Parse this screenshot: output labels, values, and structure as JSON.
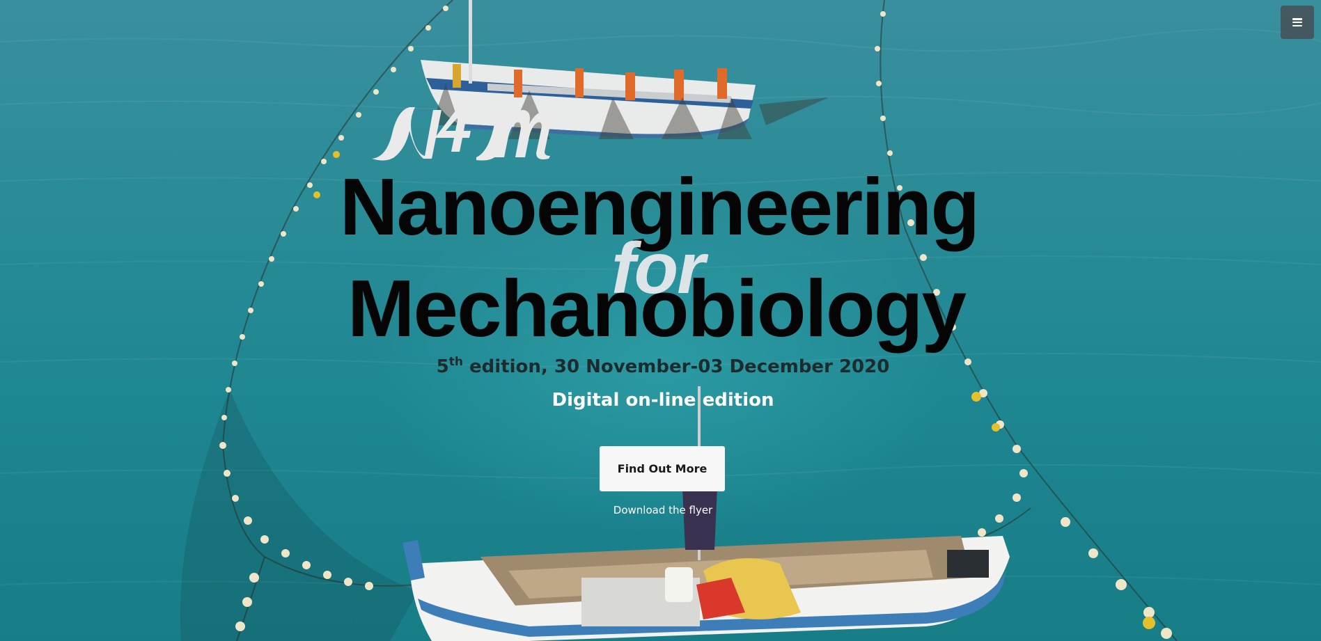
{
  "menu": {
    "icon": "hamburger-icon"
  },
  "logo": {
    "text": "N4M"
  },
  "title": {
    "line1": "Nanoengineering",
    "connector": "for",
    "line2": "Mechanobiology"
  },
  "edition": {
    "number": "5",
    "suffix": "th",
    "rest": " edition, 30 November-03 December 2020"
  },
  "subtitle": "Digital on-line edition",
  "buttons": {
    "find_out_more": "Find Out More",
    "download_flyer": "Download the flyer"
  },
  "colors": {
    "sea": "#1f8792",
    "title": "#050505",
    "button_bg": "#f7f7f7"
  }
}
